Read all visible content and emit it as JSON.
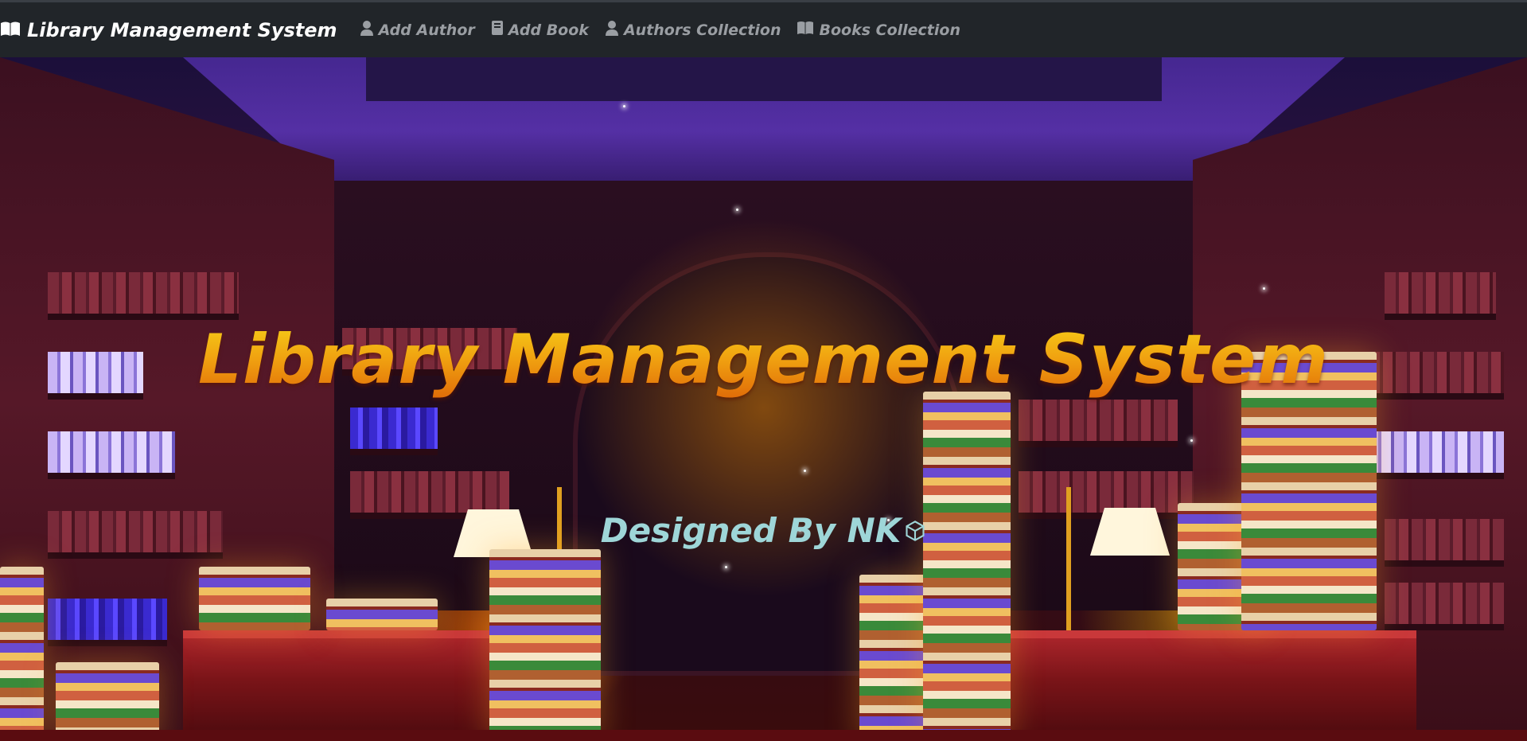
{
  "navbar": {
    "brand": "Library Management System",
    "brand_icon": "book-open-icon",
    "items": [
      {
        "label": "Add Author",
        "icon": "person-icon"
      },
      {
        "label": "Add Book",
        "icon": "book-icon"
      },
      {
        "label": "Authors Collection",
        "icon": "person-icon"
      },
      {
        "label": "Books Collection",
        "icon": "book-open-icon"
      }
    ],
    "background": "#212529",
    "text_color": "#9a9ea3"
  },
  "hero": {
    "title": "Library Management System",
    "subtitle": "Designed By NK",
    "subtitle_icon": "box-icon",
    "title_color": "#f0a010",
    "subtitle_color": "#9ed6d8"
  }
}
